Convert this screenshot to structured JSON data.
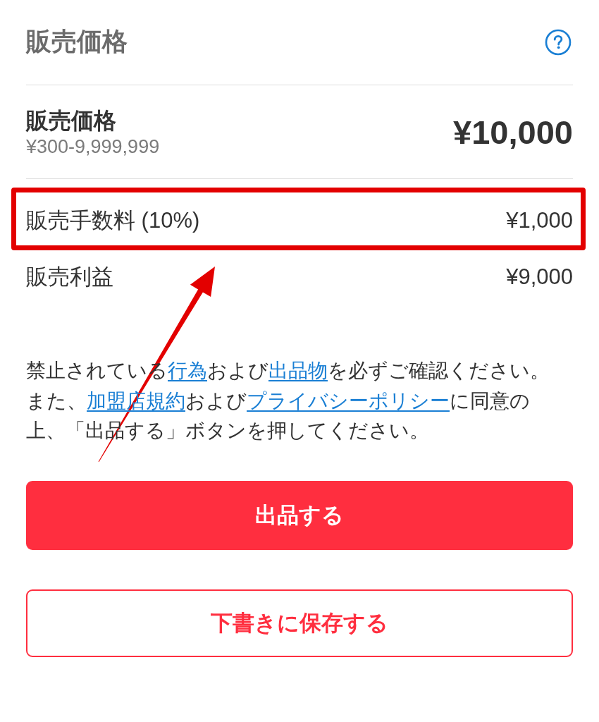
{
  "header": {
    "title": "販売価格"
  },
  "price": {
    "label": "販売価格",
    "range": "¥300-9,999,999",
    "value": "¥10,000"
  },
  "summary_rows": [
    {
      "label": "販売手数料 (10%)",
      "value": "¥1,000",
      "highlighted": true
    },
    {
      "label": "販売利益",
      "value": "¥9,000",
      "highlighted": false
    }
  ],
  "notice": {
    "lines": [
      [
        {
          "kind": "text",
          "text": "禁止されている"
        },
        {
          "kind": "link",
          "text": "行為"
        },
        {
          "kind": "text",
          "text": "および"
        },
        {
          "kind": "link",
          "text": "出品物"
        },
        {
          "kind": "text",
          "text": "を必ずご確認ください。"
        }
      ],
      [
        {
          "kind": "text",
          "text": "また、"
        },
        {
          "kind": "link",
          "text": "加盟店規約"
        },
        {
          "kind": "text",
          "text": "および"
        },
        {
          "kind": "link",
          "text": "プライバシーポリシー"
        },
        {
          "kind": "text",
          "text": "に同意の"
        }
      ],
      [
        {
          "kind": "text",
          "text": "上、「出品する」ボタンを押してください。"
        }
      ]
    ]
  },
  "buttons": [
    {
      "kind": "primary",
      "label": "出品する"
    },
    {
      "kind": "outline",
      "label": "下書きに保存する"
    }
  ]
}
